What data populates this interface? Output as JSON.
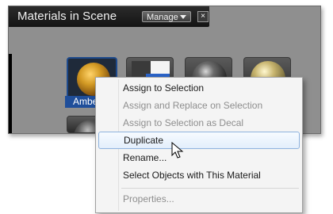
{
  "panel": {
    "title": "Materials in Scene",
    "manage_label": "Manage",
    "close_symbol": "×"
  },
  "thumbnails": [
    {
      "name": "amber-material",
      "label": "Amber",
      "selected": true
    },
    {
      "name": "checker-material",
      "label": "",
      "selected": false
    },
    {
      "name": "dark-metal-material",
      "label": "",
      "selected": false
    },
    {
      "name": "gold-metal-material",
      "label": "",
      "selected": false
    },
    {
      "name": "dark-sphere-material",
      "label": "",
      "selected": false
    }
  ],
  "context_menu": {
    "items": [
      {
        "label": "Assign to Selection",
        "disabled": false,
        "hover": false
      },
      {
        "label": "Assign and Replace on Selection",
        "disabled": true,
        "hover": false
      },
      {
        "label": "Assign to Selection as Decal",
        "disabled": true,
        "hover": false
      },
      {
        "label": "Duplicate",
        "disabled": false,
        "hover": true
      },
      {
        "label": "Rename...",
        "disabled": false,
        "hover": false
      },
      {
        "label": "Select Objects with This Material",
        "disabled": false,
        "hover": false
      },
      {
        "label": "Properties...",
        "disabled": true,
        "hover": false
      }
    ]
  },
  "colors": {
    "selection_blue": "#1f4e9a",
    "panel_gray": "#8f8f8f",
    "titlebar": "#1a1a1a"
  },
  "icons": [
    "dropdown-arrow-icon",
    "close-icon",
    "mouse-cursor-icon"
  ]
}
